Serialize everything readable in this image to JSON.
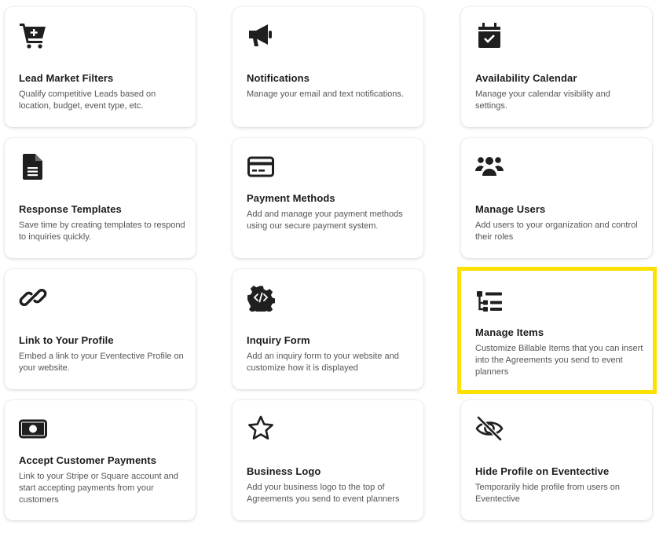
{
  "cards": [
    {
      "title": "Lead Market Filters",
      "description": "Qualify competitive Leads based on location, budget, event type, etc.",
      "icon": "cart-plus-icon"
    },
    {
      "title": "Notifications",
      "description": "Manage your email and text notifications.",
      "icon": "megaphone-icon"
    },
    {
      "title": "Availability Calendar",
      "description": "Manage your calendar visibility and settings.",
      "icon": "calendar-check-icon"
    },
    {
      "title": "Response Templates",
      "description": "Save time by creating templates to respond to inquiries quickly.",
      "icon": "file-lines-icon"
    },
    {
      "title": "Payment Methods",
      "description": "Add and manage your payment methods using our secure payment system.",
      "icon": "credit-card-icon"
    },
    {
      "title": "Manage Users",
      "description": "Add users to your organization and control their roles",
      "icon": "users-icon"
    },
    {
      "title": "Link to Your Profile",
      "description": "Embed a link to your Eventective Profile on your website.",
      "icon": "link-icon"
    },
    {
      "title": "Inquiry Form",
      "description": "Add an inquiry form to your website and customize how it is displayed",
      "icon": "code-gear-icon"
    },
    {
      "title": "Manage Items",
      "description": "Customize Billable Items that you can insert into the Agreements you send to event planners",
      "icon": "list-tree-icon"
    },
    {
      "title": "Accept Customer Payments",
      "description": "Link to your Stripe or Square account and start accepting payments from your customers",
      "icon": "money-bill-icon"
    },
    {
      "title": "Business Logo",
      "description": "Add your business logo to the top of Agreements you send to event planners",
      "icon": "star-icon"
    },
    {
      "title": "Hide Profile on Eventective",
      "description": "Temporarily hide profile from users on Eventective",
      "icon": "eye-slash-icon"
    }
  ],
  "colors": {
    "highlight": "#ffe100",
    "icon": "#1f1f1f",
    "title": "#1c1c1c",
    "description": "#555555"
  }
}
